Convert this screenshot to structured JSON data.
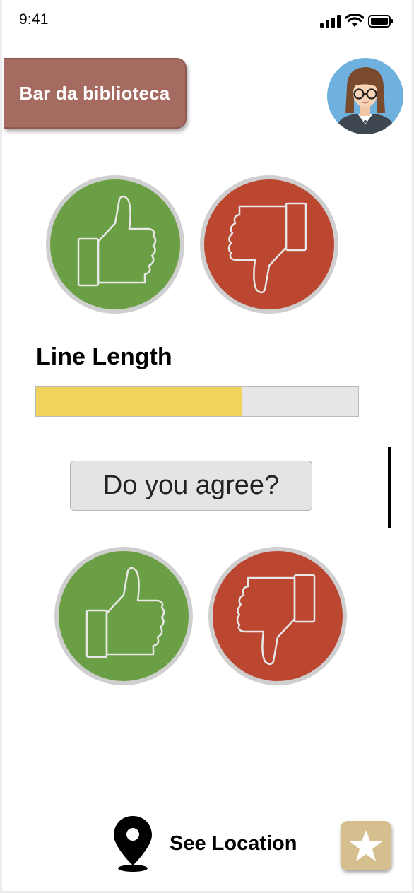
{
  "status_bar": {
    "time": "9:41",
    "icons": [
      "cellular-signal-icon",
      "wifi-icon",
      "battery-icon"
    ]
  },
  "header": {
    "title": "Bar da biblioteca",
    "title_bg_color": "#a56b61",
    "avatar": "user-avatar"
  },
  "vote_top": {
    "up_icon": "thumbs-up-icon",
    "down_icon": "thumbs-down-icon",
    "up_color": "#6b9f45",
    "down_color": "#bb4730"
  },
  "line_meter": {
    "label": "Line Length",
    "level_percent": 64,
    "fill_color": "#f0d35c"
  },
  "question": {
    "label": "Do you agree?"
  },
  "vote_bottom": {
    "up_icon": "thumbs-up-icon",
    "down_icon": "thumbs-down-icon"
  },
  "footer": {
    "location_label": "See Location",
    "location_icon": "map-pin-icon",
    "favorite_icon": "star-icon",
    "favorite_color": "#d6bf8e"
  }
}
